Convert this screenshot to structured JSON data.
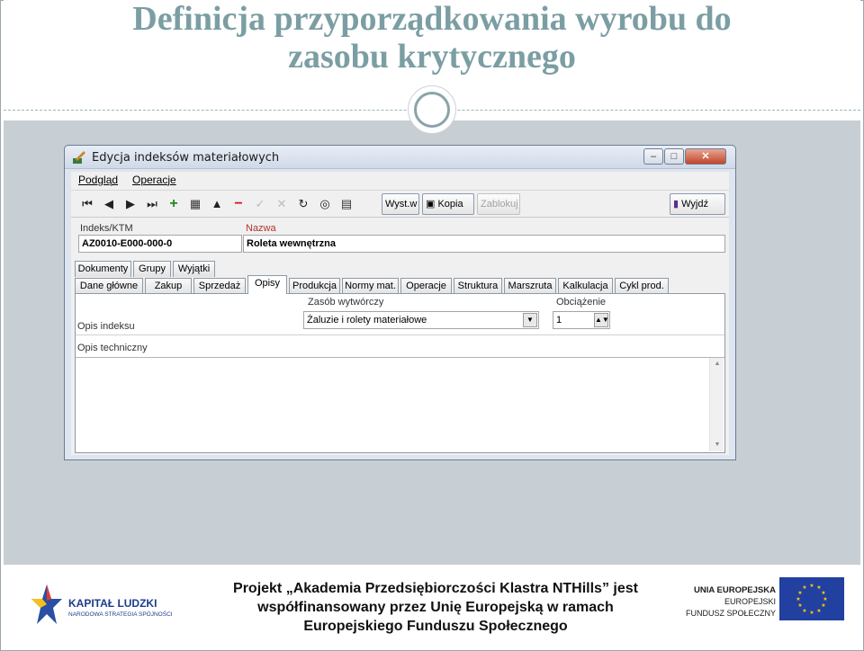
{
  "slide": {
    "title_line1": "Definicja przyporządkowania wyrobu do",
    "title_line2": "zasobu krytycznego"
  },
  "window": {
    "title": "Edycja indeksów materiałowych",
    "btn_minimize": "–",
    "btn_maximize": "□",
    "btn_close": "✕"
  },
  "menu": {
    "items": [
      "Podgląd",
      "Operacje"
    ]
  },
  "toolbar": {
    "wyst_label": "Wyst.w",
    "kopia_label": "Kopia",
    "zablokuj_label": "Zablokuj",
    "wyjdz_label": "Wyjdź"
  },
  "form": {
    "index_label": "Indeks/KTM",
    "index_value": "AZ0010-E000-000-0",
    "name_label": "Nazwa",
    "name_value": "Roleta wewnętrzna",
    "tabs_row1": [
      "Dokumenty",
      "Grupy",
      "Wyjątki"
    ],
    "tabs_row2": [
      "Dane główne",
      "Zakup",
      "Sprzedaż",
      "Opisy",
      "Produkcja",
      "Normy mat.",
      "Operacje",
      "Struktura",
      "Marszruta",
      "Kalkulacja",
      "Cykl prod."
    ],
    "active_tab": "Opisy",
    "zasob_label": "Zasób wytwórczy",
    "zasob_value": "Żaluzie i rolety materiałowe",
    "obciazenie_label": "Obciążenie",
    "obciazenie_value": "1",
    "opis_indeksu_label": "Opis indeksu",
    "opis_techniczny_label": "Opis techniczny"
  },
  "footer": {
    "kl_title": "KAPITAŁ LUDZKI",
    "kl_subtitle": "NARODOWA STRATEGIA SPÓJNOŚCI",
    "project_line1": "Projekt „Akademia Przedsiębiorczości Klastra NTHills” jest",
    "project_line2": "współfinansowany przez Unię Europejską w ramach",
    "project_line3": "Europejskiego Funduszu Społecznego",
    "eu_line1": "UNIA EUROPEJSKA",
    "eu_line2": "EUROPEJSKI",
    "eu_line3": "FUNDUSZ SPOŁECZNY"
  },
  "colors": {
    "title": "#7b9ea3",
    "content_bg": "#c7cfd4",
    "eu_blue": "#2240a0",
    "eu_star": "#ffcc00"
  }
}
